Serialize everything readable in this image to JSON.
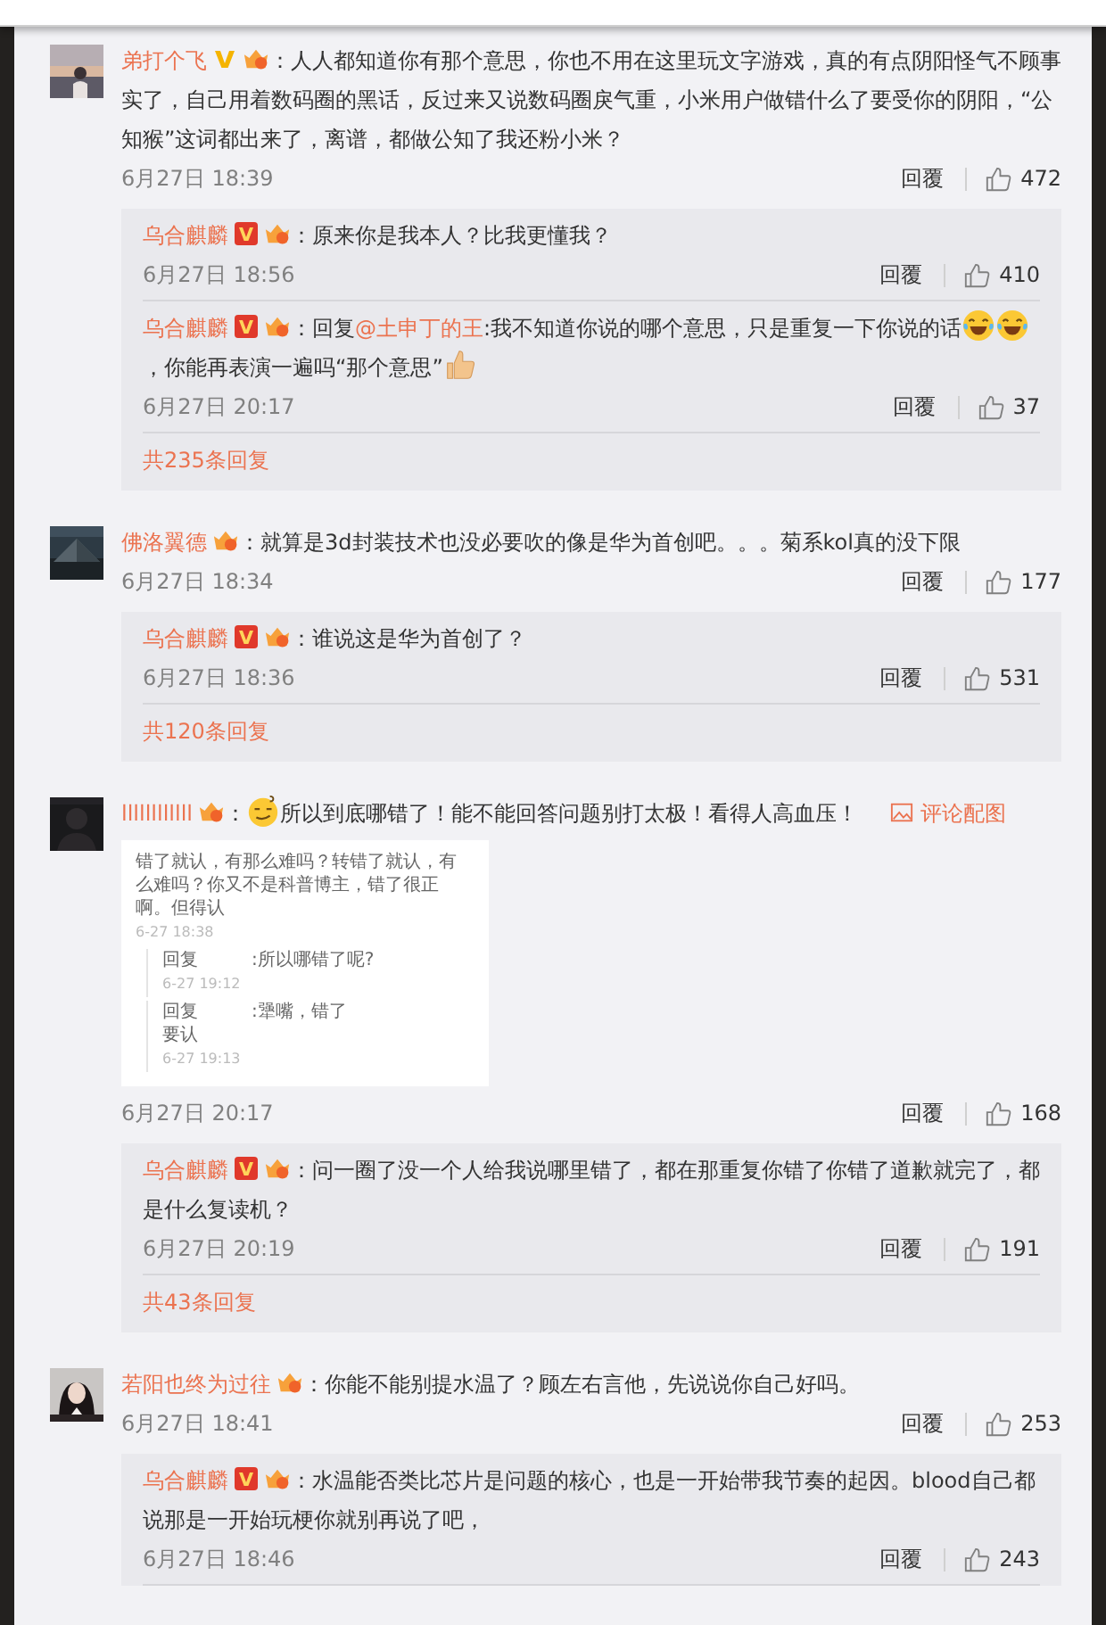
{
  "comments": [
    {
      "user": "弟打个飞",
      "verified": true,
      "badge": {
        "kind": "plain",
        "color": "#f5b400"
      },
      "content": [
        {
          "kind": "text",
          "text": "：人人都知道你有那个意思，你也不用在这里玩文字游戏，真的有点阴阳怪气不顾事实了，自己用着数码圈的黑话，反过来又说数码圈戾气重，小米用户做错什么了要受你的阴阳，“公知猴”这词都出来了，离谱，都做公知了我还粉小米？"
        }
      ],
      "time": "6月27日 18:39",
      "reply_label": "回覆",
      "likes": "472",
      "replies": [
        {
          "user": "乌合麒麟",
          "verified": true,
          "badge": {
            "kind": "boxed",
            "color": "#e0392b"
          },
          "content": [
            {
              "kind": "text",
              "text": "：原来你是我本人？比我更懂我？"
            }
          ],
          "time": "6月27日 18:56",
          "reply_label": "回覆",
          "likes": "410"
        },
        {
          "user": "乌合麒麟",
          "verified": true,
          "badge": {
            "kind": "boxed",
            "color": "#e0392b"
          },
          "content": [
            {
              "kind": "text",
              "text": "：回复"
            },
            {
              "kind": "mention",
              "text": "@土申丁的王"
            },
            {
              "kind": "text",
              "text": ":我不知道你说的哪个意思，只是重复一下你说的话"
            },
            {
              "kind": "laugh"
            },
            {
              "kind": "laugh"
            },
            {
              "kind": "text",
              "text": "，你能再表演一遍吗“那个意思”"
            },
            {
              "kind": "thumbs"
            }
          ],
          "time": "6月27日 20:17",
          "reply_label": "回覆",
          "likes": "37"
        }
      ],
      "more_replies": "共235条回复"
    },
    {
      "user": "佛洛翼德",
      "verified": false,
      "content": [
        {
          "kind": "text",
          "text": "：就算是3d封装技术也没必要吹的像是华为首创吧。。。菊系kol真的没下限"
        }
      ],
      "time": "6月27日 18:34",
      "reply_label": "回覆",
      "likes": "177",
      "replies": [
        {
          "user": "乌合麒麟",
          "verified": true,
          "badge": {
            "kind": "boxed",
            "color": "#e0392b"
          },
          "content": [
            {
              "kind": "text",
              "text": "：谁说这是华为首创了？"
            }
          ],
          "time": "6月27日 18:36",
          "reply_label": "回覆",
          "likes": "531"
        }
      ],
      "more_replies": "共120条回复"
    },
    {
      "user": "llllllllllll",
      "verified": false,
      "content": [
        {
          "kind": "text",
          "text": "："
        },
        {
          "kind": "smirk"
        },
        {
          "kind": "text",
          "text": "所以到底哪错了！能不能回答问题别打太极！看得人高血压！"
        }
      ],
      "image_link": "评论配图",
      "attachment": {
        "post_lines": [
          "错了就认，有那么难吗？转错了就认，有",
          "么难吗？你又不是科普博主，错了很正",
          "啊。但得认"
        ],
        "post_time": "6-27 18:38",
        "replies": [
          {
            "label": "回复",
            "lines": [
              ":所以哪错了呢?"
            ],
            "time": "6-27 19:12"
          },
          {
            "label": "回复",
            "lines": [
              ":犟嘴，错了",
              "要认"
            ],
            "time": "6-27 19:13"
          }
        ]
      },
      "time": "6月27日 20:17",
      "reply_label": "回覆",
      "likes": "168",
      "replies": [
        {
          "user": "乌合麒麟",
          "verified": true,
          "badge": {
            "kind": "boxed",
            "color": "#e0392b"
          },
          "content": [
            {
              "kind": "text",
              "text": "：问一圈了没一个人给我说哪里错了，都在那重复你错了你错了道歉就完了，都是什么复读机？"
            }
          ],
          "time": "6月27日 20:19",
          "reply_label": "回覆",
          "likes": "191"
        }
      ],
      "more_replies": "共43条回复"
    },
    {
      "user": "若阳也终为过往",
      "verified": false,
      "content": [
        {
          "kind": "text",
          "text": "：你能不能别提水温了？顾左右言他，先说说你自己好吗。"
        }
      ],
      "time": "6月27日 18:41",
      "reply_label": "回覆",
      "likes": "253",
      "replies": [
        {
          "user": "乌合麒麟",
          "verified": true,
          "badge": {
            "kind": "boxed",
            "color": "#e0392b"
          },
          "content": [
            {
              "kind": "text",
              "text": "：水温能否类比芯片是问题的核心，也是一开始带我节奏的起因。blood自己都说那是一开始玩梗你就别再说了吧，"
            }
          ],
          "time": "6月27日 18:46",
          "reply_label": "回覆",
          "likes": "243"
        }
      ]
    }
  ]
}
